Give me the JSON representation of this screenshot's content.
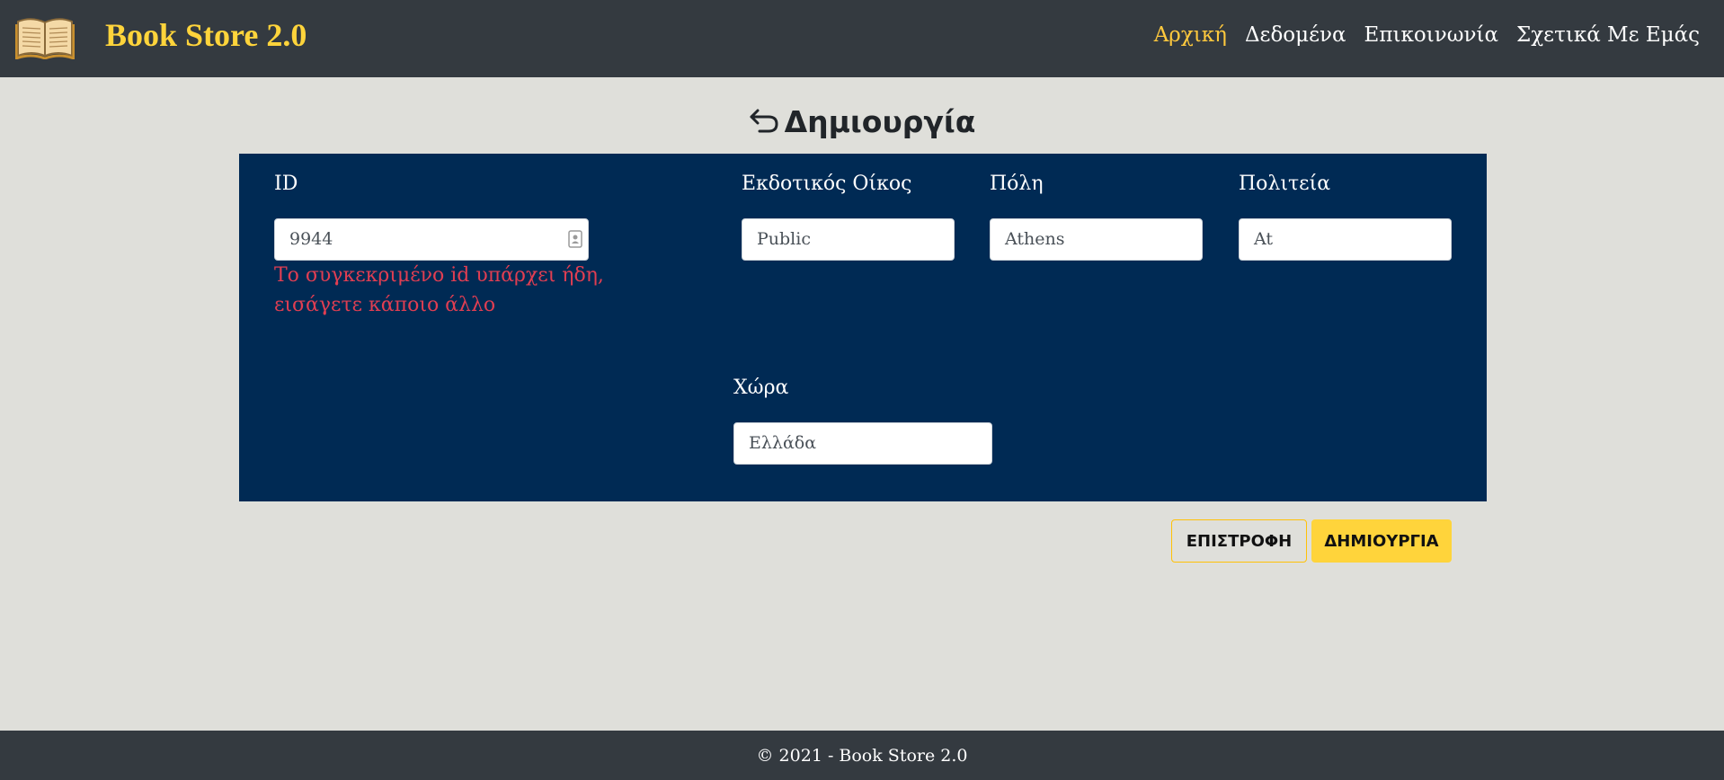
{
  "navbar": {
    "brand": "Book Store 2.0",
    "links": [
      "Αρχική",
      "Δεδομένα",
      "Επικοινωνία",
      "Σχετικά Με Εμάς"
    ],
    "active_index": 0
  },
  "page": {
    "title": "Δημιουργία"
  },
  "form": {
    "id": {
      "label": "ID",
      "value": "9944",
      "error": "Το συγκεκριμένο id υπάρχει ήδη, εισάγετε κάποιο άλλο"
    },
    "publisher": {
      "label": "Εκδοτικός Οίκος",
      "value": "Public"
    },
    "city": {
      "label": "Πόλη",
      "value": "Athens"
    },
    "state": {
      "label": "Πολιτεία",
      "value": "At"
    },
    "country": {
      "label": "Χώρα",
      "value": "Ελλάδα"
    }
  },
  "buttons": {
    "back_label": "ΕΠΙΣΤΡΟΦΗ",
    "create_label": "ΔΗΜΙΟΥΡΓΙΑ"
  },
  "footer": {
    "text": "© 2021 - Book Store 2.0"
  },
  "colors": {
    "navbar_bg": "#343a40",
    "brand": "#ffd43b",
    "panel_bg": "#002a54",
    "error": "#e03e52",
    "accent_button": "#ffd43b"
  }
}
